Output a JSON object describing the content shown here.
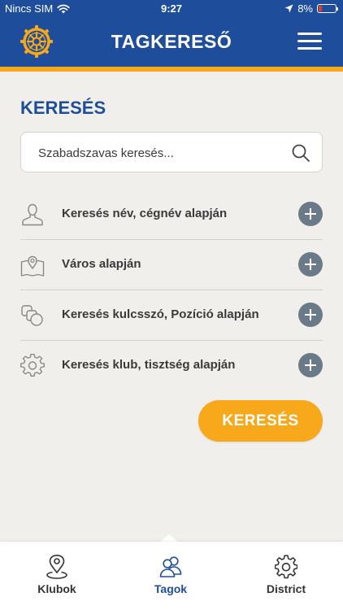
{
  "status_bar": {
    "carrier": "Nincs SIM",
    "time": "9:27",
    "battery": "8%",
    "battery_level": 0.08,
    "icons": [
      "wifi-icon",
      "location-arrow-icon",
      "battery-icon"
    ]
  },
  "header": {
    "title": "TAGKERESŐ",
    "logo": "rotary-wheel-logo",
    "menu_icon": "hamburger-menu-icon"
  },
  "search": {
    "heading": "KERESÉS",
    "placeholder": "Szabadszavas keresés...",
    "value": "",
    "icon": "search-icon"
  },
  "filters": [
    {
      "label": "Keresés név, cégnév alapján",
      "icon": "person-icon"
    },
    {
      "label": "Város alapján",
      "icon": "map-pin-icon"
    },
    {
      "label": "Keresés kulcsszó, Pozíció alapján",
      "icon": "shapes-icon"
    },
    {
      "label": "Keresés klub, tisztség alapján",
      "icon": "gear-icon"
    }
  ],
  "search_button": {
    "label": "KERESÉS"
  },
  "tabs": [
    {
      "label": "Klubok",
      "icon": "location-pin-icon",
      "active": false
    },
    {
      "label": "Tagok",
      "icon": "people-icon",
      "active": true
    },
    {
      "label": "District",
      "icon": "gear-icon",
      "active": false
    }
  ],
  "colors": {
    "primary_blue": "#1d4d9b",
    "accent_orange": "#f7a81b",
    "background": "#f1efec",
    "plus_button": "#6b7a89"
  }
}
